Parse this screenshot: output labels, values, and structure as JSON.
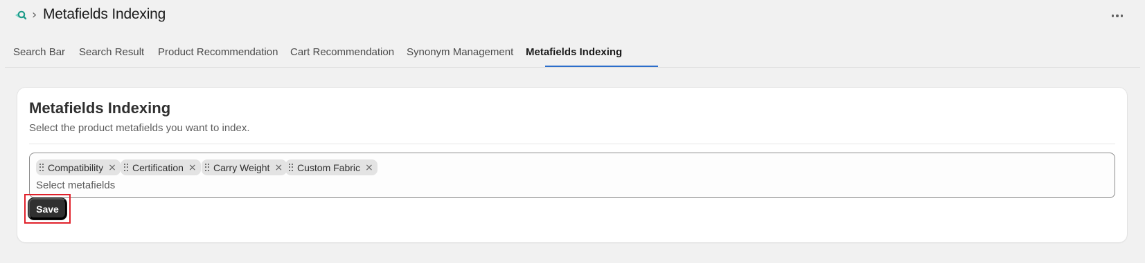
{
  "header": {
    "app_icon": "search-magnifier-icon",
    "breadcrumb_separator": "›",
    "title": "Metafields Indexing",
    "more_icon": "more-horizontal-icon"
  },
  "tabs": [
    {
      "label": "Search Bar",
      "active": false
    },
    {
      "label": "Search Result",
      "active": false
    },
    {
      "label": "Product Recommendation",
      "active": false
    },
    {
      "label": "Cart Recommendation",
      "active": false
    },
    {
      "label": "Synonym Management",
      "active": false
    },
    {
      "label": "Metafields Indexing",
      "active": true
    }
  ],
  "card": {
    "title": "Metafields Indexing",
    "subtitle": "Select the product metafields you want to index.",
    "multiselect": {
      "selected": [
        {
          "label": "Compatibility"
        },
        {
          "label": "Certification"
        },
        {
          "label": "Carry Weight"
        },
        {
          "label": "Custom Fabric"
        }
      ],
      "placeholder": "Select metafields",
      "remove_glyph": "×"
    },
    "save_label": "Save"
  },
  "colors": {
    "accent": "#2c6ecb",
    "primary_button": "#303030",
    "highlight": "#e0202a",
    "background": "#f1f1f1"
  }
}
